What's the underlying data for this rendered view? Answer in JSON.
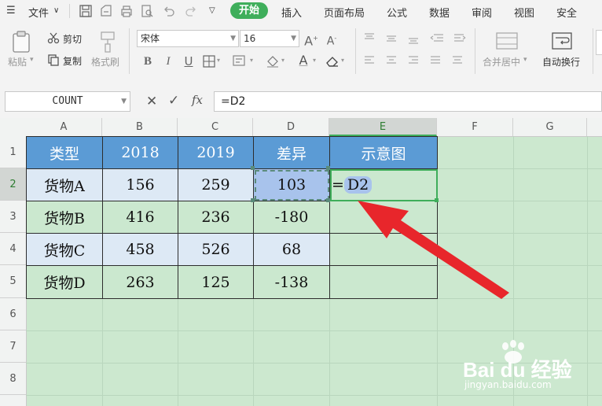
{
  "menubar": {
    "file_label": "文件",
    "tabs": [
      "开始",
      "插入",
      "页面布局",
      "公式",
      "数据",
      "审阅",
      "视图",
      "安全"
    ],
    "active_tab": "开始"
  },
  "ribbon": {
    "paste": "粘贴",
    "cut": "剪切",
    "copy": "复制",
    "format_painter": "格式刷",
    "font_name": "宋体",
    "font_size": "16",
    "merge_center": "合并居中",
    "auto_wrap": "自动换行"
  },
  "formula_bar": {
    "name_box": "COUNT",
    "fx_label": "fx",
    "formula": "=D2"
  },
  "columns": [
    "A",
    "B",
    "C",
    "D",
    "E",
    "F",
    "G"
  ],
  "selected_column": "E",
  "rows": [
    "1",
    "2",
    "3",
    "4",
    "5",
    "6",
    "7",
    "8"
  ],
  "selected_row": "2",
  "table": {
    "headers": [
      "类型",
      "2018",
      "2019",
      "差异",
      "示意图"
    ],
    "rows": [
      {
        "type": "货物A",
        "y2018": "156",
        "y2019": "259",
        "diff": "103",
        "chart": "=D2"
      },
      {
        "type": "货物B",
        "y2018": "416",
        "y2019": "236",
        "diff": "-180",
        "chart": ""
      },
      {
        "type": "货物C",
        "y2018": "458",
        "y2019": "526",
        "diff": "68",
        "chart": ""
      },
      {
        "type": "货物D",
        "y2018": "263",
        "y2019": "125",
        "diff": "-138",
        "chart": ""
      }
    ]
  },
  "edit_cell": {
    "eq": "=",
    "ref": "D2"
  },
  "watermark": {
    "brand": "Bai du 经验",
    "url": "jingyan.baidu.com"
  },
  "colors": {
    "accent": "#3fae5b",
    "header_fill": "#5b9bd5",
    "sheet_bg": "#cce8cf",
    "arrow": "#e8262b"
  }
}
